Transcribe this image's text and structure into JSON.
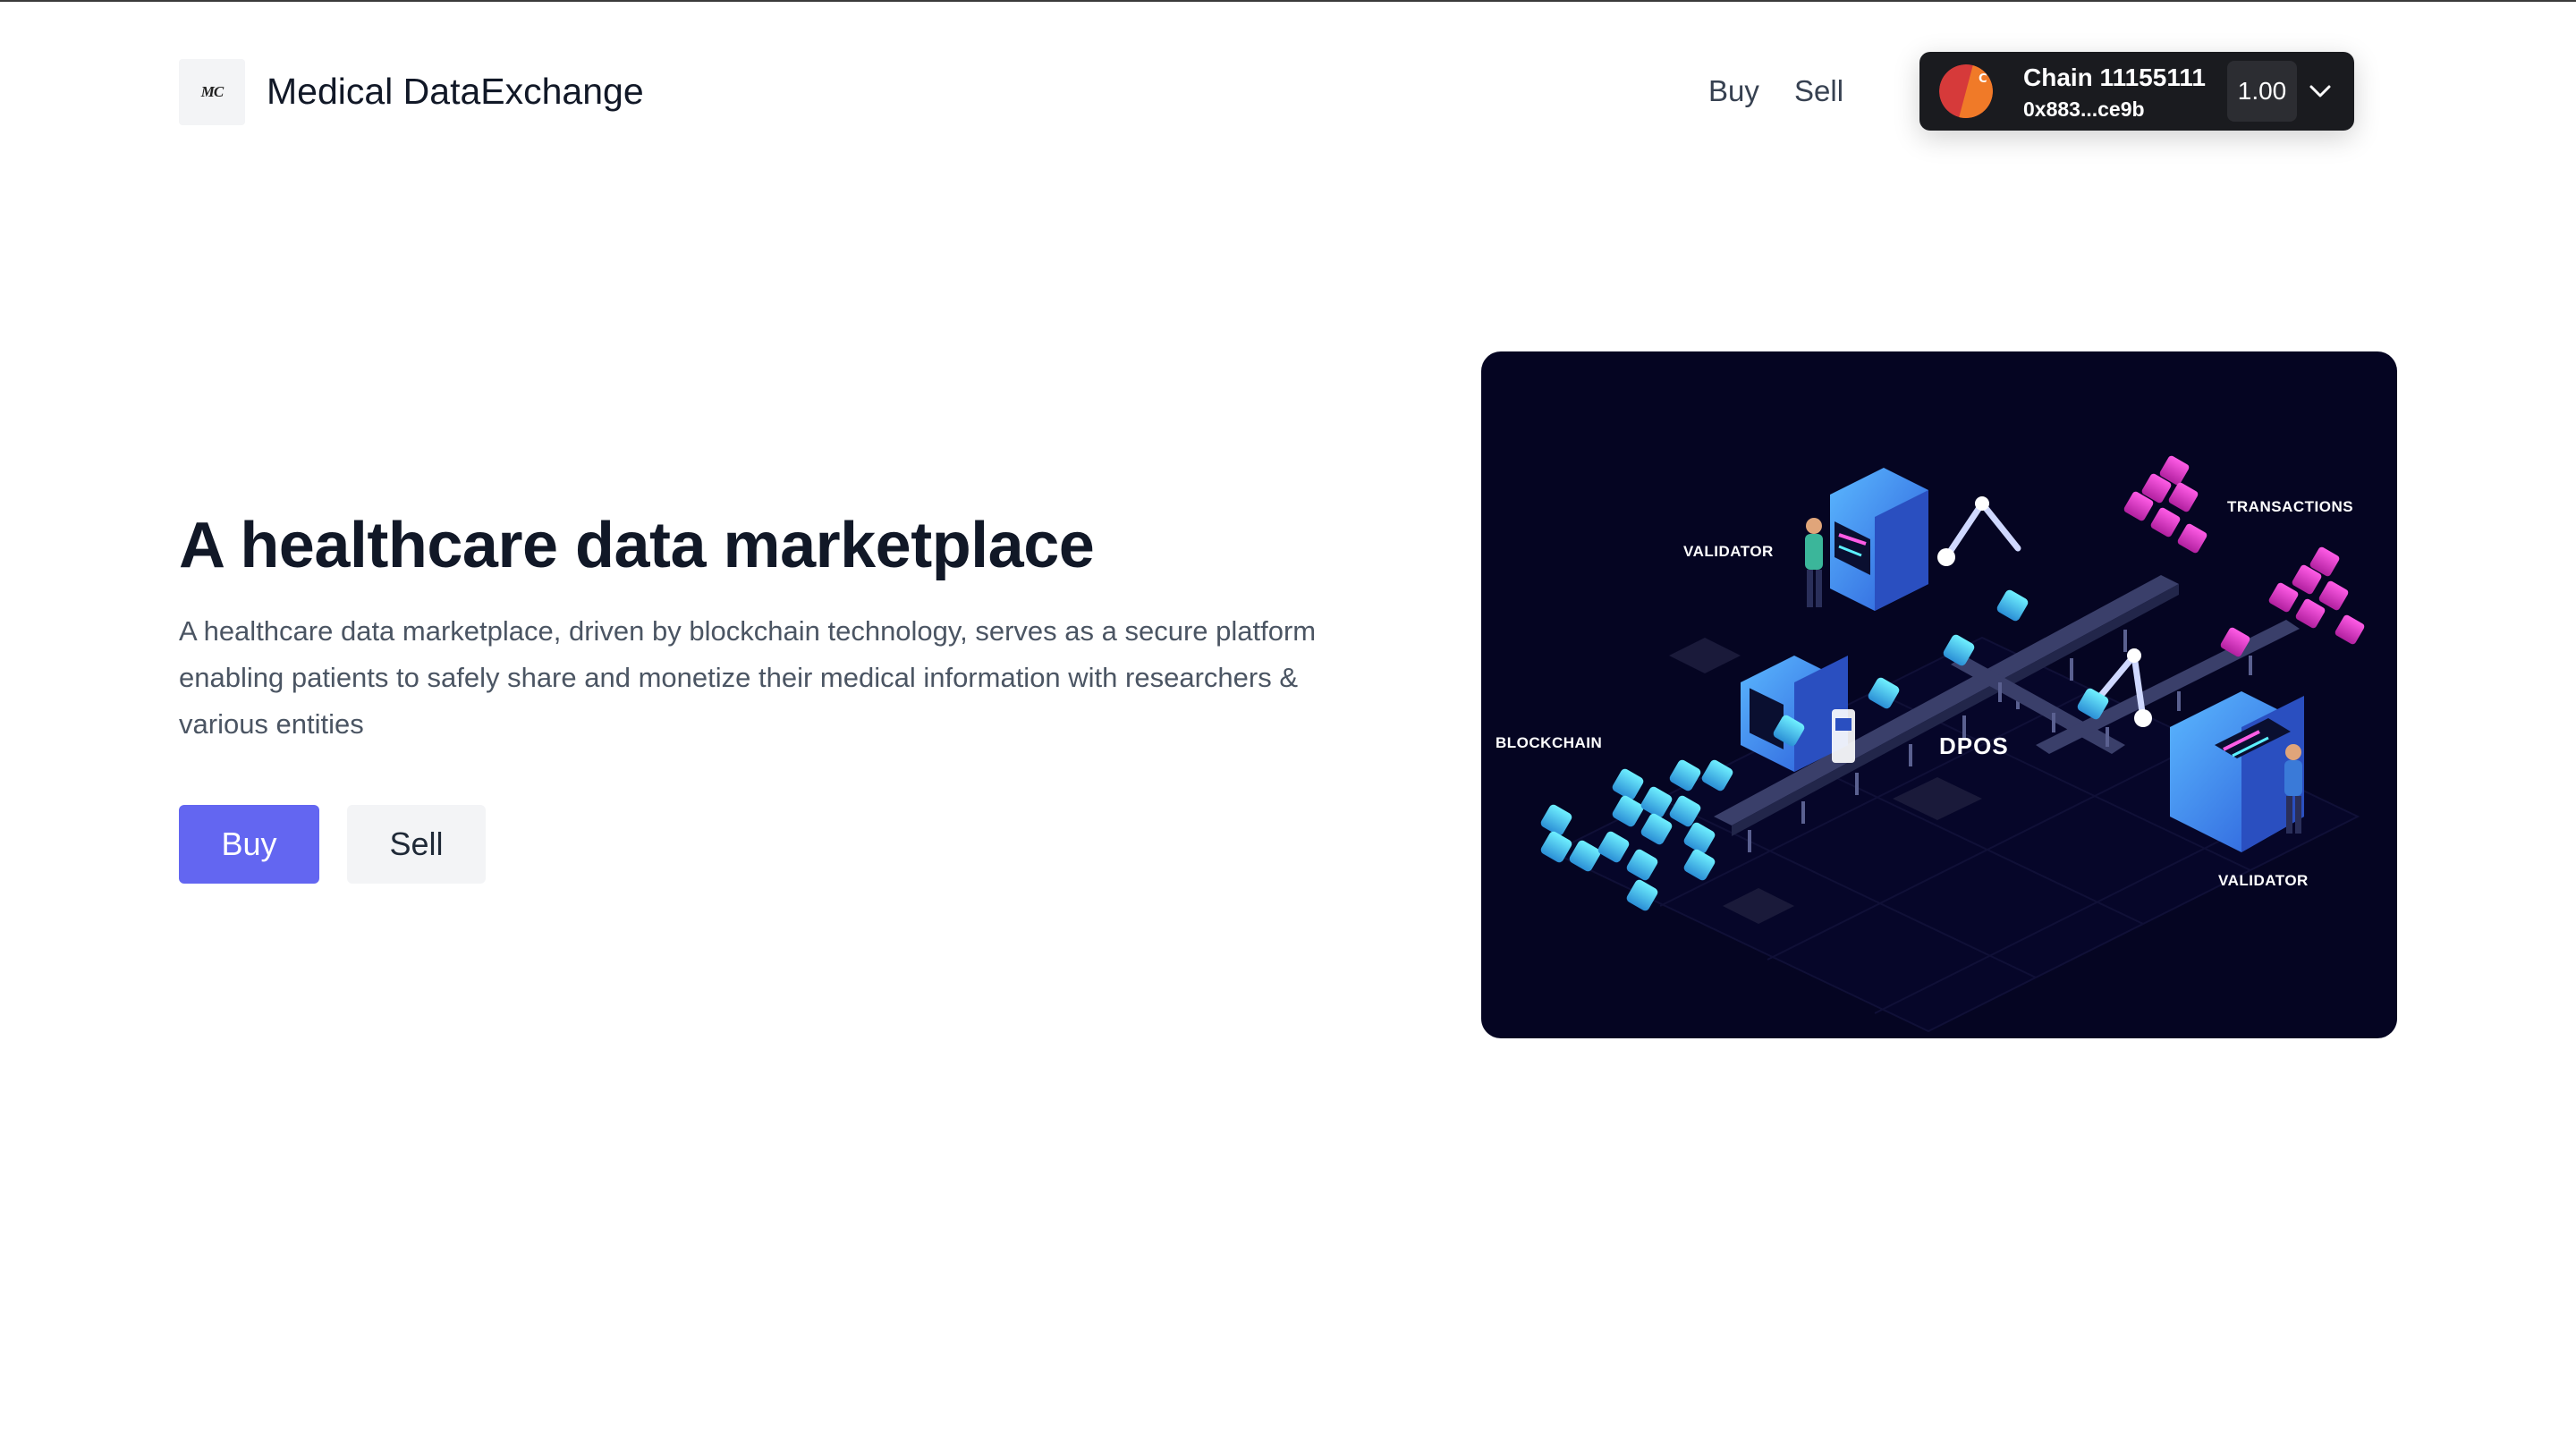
{
  "header": {
    "logo_text": "MC",
    "brand": "Medical DataExchange",
    "nav": [
      {
        "label": "Buy"
      },
      {
        "label": "Sell"
      }
    ]
  },
  "wallet": {
    "chain": "Chain 11155111",
    "address": "0x883...ce9b",
    "balance": "1.00",
    "avatar_letter": "C"
  },
  "hero": {
    "title": "A healthcare data marketplace",
    "description": "A healthcare data marketplace, driven by blockchain technology, serves as a secure platform enabling patients to safely share and monetize their medical information with researchers & various entities",
    "buttons": {
      "buy": "Buy",
      "sell": "Sell"
    }
  },
  "illustration": {
    "labels": {
      "validator_top": "VALIDATOR",
      "transactions": "TRANSACTIONS",
      "blockchain": "BLOCKCHAIN",
      "dpos": "DPOS",
      "validator_bottom": "VALIDATOR"
    }
  },
  "colors": {
    "accent": "#6366f1",
    "image_bg": "#050522",
    "wallet_bg": "#1a1b1f"
  }
}
